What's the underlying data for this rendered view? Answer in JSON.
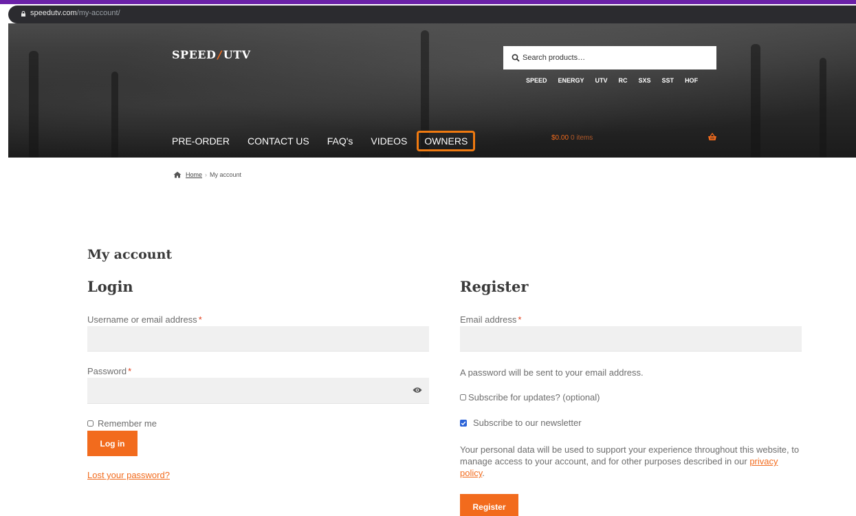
{
  "browser": {
    "url_host": "speedutv.com",
    "url_path": "/my-account/"
  },
  "header": {
    "logo_left": "SPEED",
    "logo_slash": "/",
    "logo_right": "UTV",
    "search_placeholder": "Search products…",
    "secondary_nav": [
      "SPEED",
      "ENERGY",
      "UTV",
      "RC",
      "SXS",
      "SST",
      "HOF"
    ],
    "main_nav": [
      "PRE-ORDER",
      "CONTACT US",
      "FAQ's",
      "VIDEOS",
      "OWNERS"
    ],
    "highlighted_nav": "OWNERS",
    "highlight_color": "#f07a10",
    "cart_total": "$0.00",
    "cart_items": "0 items"
  },
  "breadcrumb": {
    "home": "Home",
    "separator": "›",
    "current": "My account"
  },
  "page": {
    "title": "My account",
    "accent_color": "#f26b1d"
  },
  "login": {
    "heading": "Login",
    "username_label": "Username or email address",
    "username_value": "",
    "password_label": "Password",
    "password_value": "",
    "required_mark": "*",
    "remember_label": "Remember me",
    "remember_checked": false,
    "submit_label": "Log in",
    "lost_password": "Lost your password?"
  },
  "register": {
    "heading": "Register",
    "email_label": "Email address",
    "email_value": "",
    "required_mark": "*",
    "password_note": "A password will be sent to your email address.",
    "subscribe_updates_label": "Subscribe for updates? (optional)",
    "subscribe_updates_checked": false,
    "newsletter_label": "Subscribe to our newsletter",
    "newsletter_checked": true,
    "privacy_text": "Your personal data will be used to support your experience throughout this website, to manage access to your account, and for other purposes described in our",
    "privacy_link": "privacy policy",
    "privacy_end": ".",
    "submit_label": "Register"
  }
}
